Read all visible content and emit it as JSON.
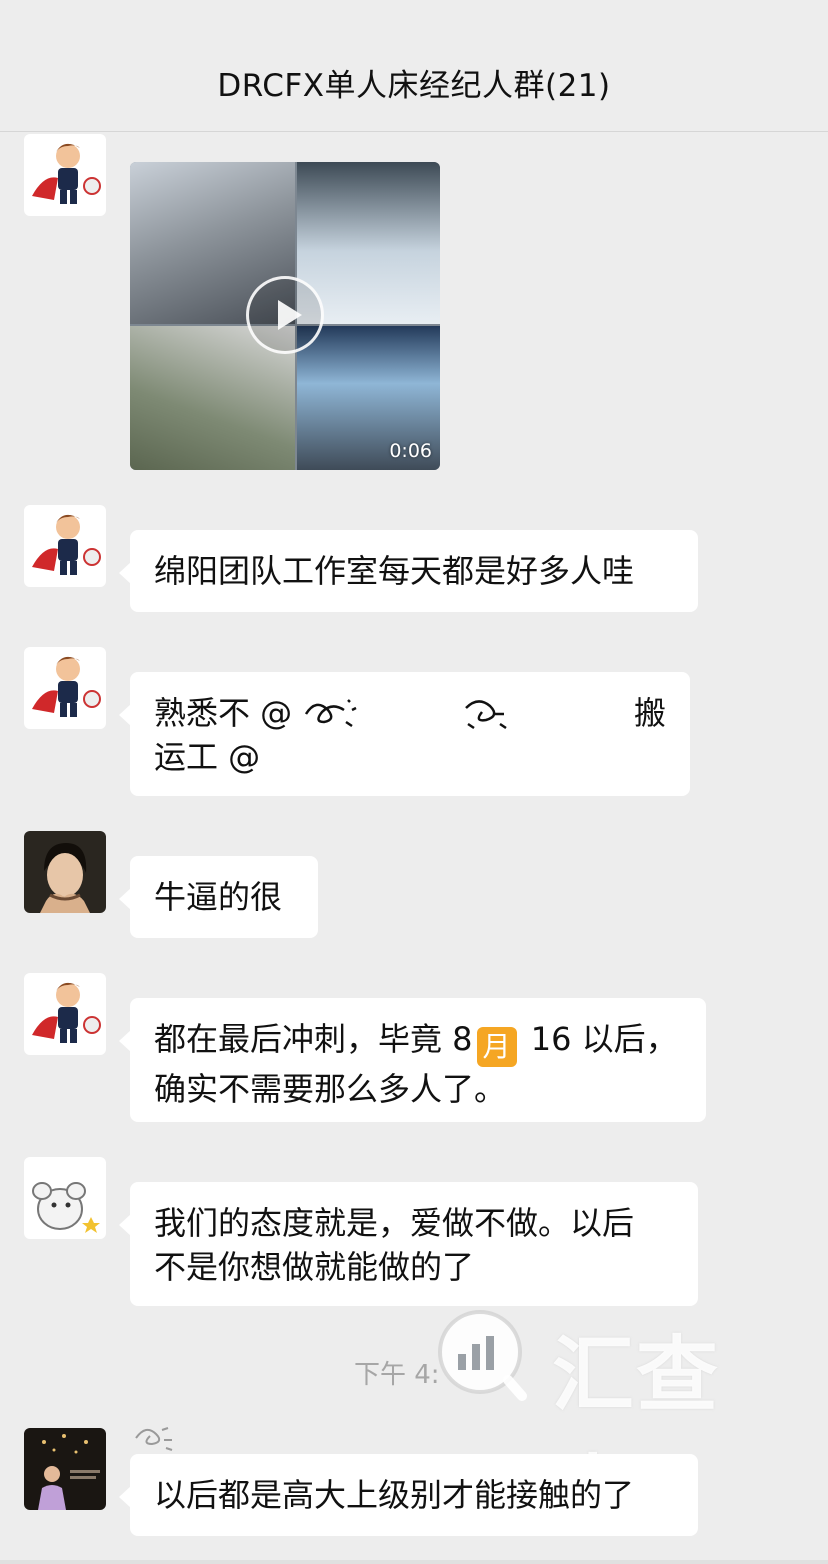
{
  "header": {
    "title": "DRCFX单人床经纪人群(21)"
  },
  "messages": [
    {
      "avatar": "cartoon-superhero-avatar",
      "type": "video",
      "duration": "0:06"
    },
    {
      "avatar": "cartoon-superhero-avatar",
      "type": "text",
      "line1": "绵阳团队工作室每天都是好多人哇"
    },
    {
      "avatar": "cartoon-superhero-avatar",
      "type": "text",
      "line1a": "熟悉不 @",
      "line1b": "搬",
      "line2": "运工 @"
    },
    {
      "avatar": "person-photo-avatar",
      "type": "text",
      "line1": "牛逼的很"
    },
    {
      "avatar": "cartoon-superhero-avatar",
      "type": "text",
      "line1a": "都在最后冲刺，毕竟 8",
      "badge": "月",
      "line1b": " 16 以后，",
      "line2": "确实不需要那么多人了。"
    },
    {
      "avatar": "mouse-sketch-avatar",
      "type": "text",
      "line1": "我们的态度就是，爱做不做。以后",
      "line2": "不是你想做就能做的了"
    },
    {
      "avatar": "speaker-photo-avatar",
      "type": "text",
      "line1": "以后都是高大上级别才能接触的了"
    }
  ],
  "timestamp": "下午 4:",
  "watermark": "汇查查",
  "colors": {
    "background": "#ededed",
    "bubble": "#ffffff",
    "badge": "#f5a623"
  }
}
